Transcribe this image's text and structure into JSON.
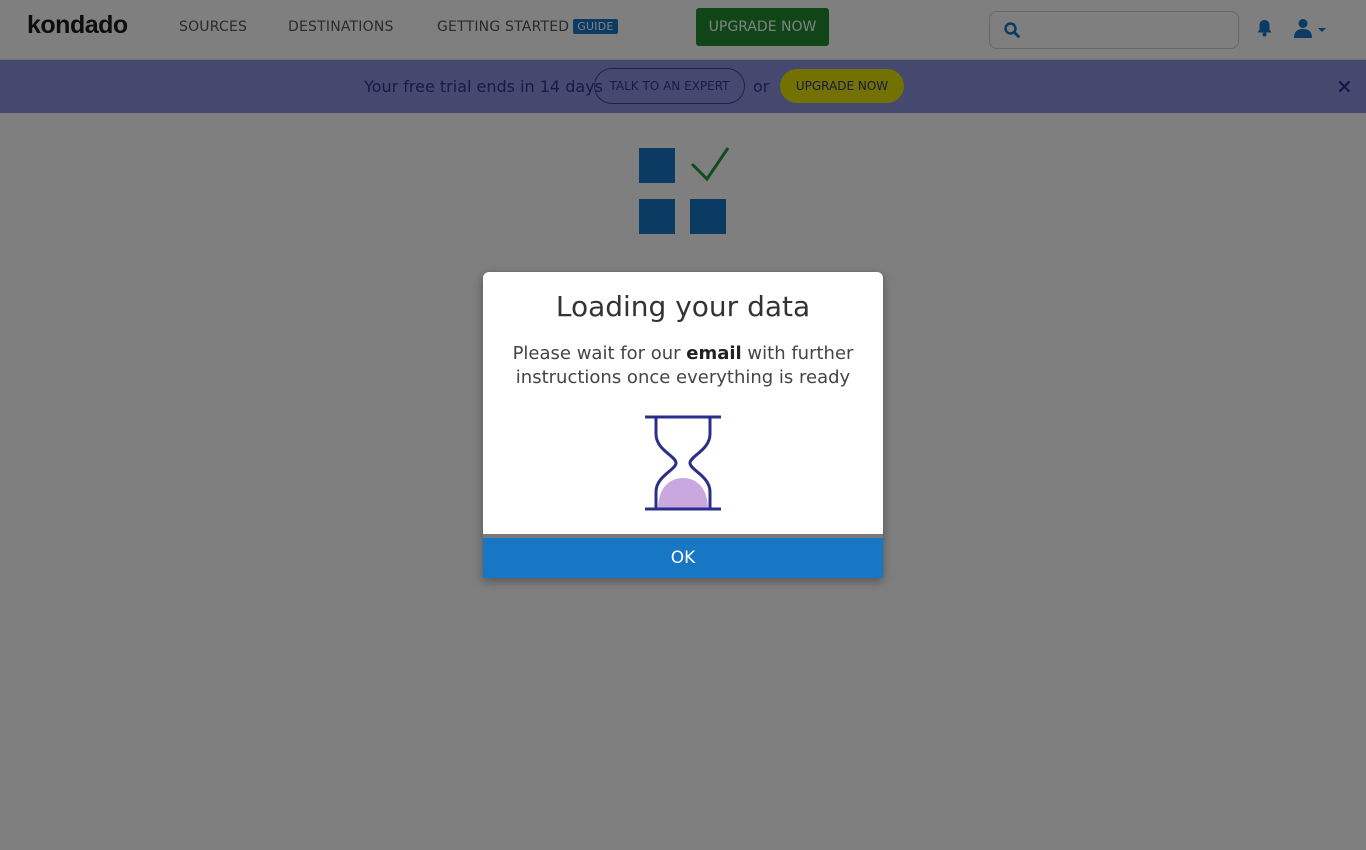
{
  "topnav": {
    "logo": "kondado",
    "links": {
      "sources": "SOURCES",
      "destinations": "DESTINATIONS",
      "getting_started": "GETTING STARTED",
      "guide_badge": "GUIDE"
    },
    "upgrade_label": "UPGRADE NOW",
    "search_placeholder": "",
    "search_value": ""
  },
  "banner": {
    "trial_text": "Your free trial ends in 14 days",
    "talk_expert_label": "TALK TO AN EXPERT",
    "or_text": "or",
    "upgrade_label": "UPGRADE NOW",
    "close_symbol": "×"
  },
  "modal": {
    "title": "Loading your data",
    "message_before": "Please wait for our ",
    "message_bold": "email",
    "message_after": " with further instructions once everything is ready",
    "ok_label": "OK"
  },
  "colors": {
    "upgrade_green": "#1f8a2e",
    "banner_bg": "#8a92df",
    "banner_upgrade_yellow": "#e6e300",
    "primary_blue": "#1777c4",
    "hourglass_stroke": "#2c2f8a",
    "hourglass_sand": "#c9a8e0"
  },
  "icons": {
    "search": "search-icon",
    "bell": "bell-icon",
    "user": "user-icon",
    "caret": "caret-down-icon",
    "app": "grid-check-icon",
    "hourglass": "hourglass-icon",
    "close": "close-icon"
  }
}
